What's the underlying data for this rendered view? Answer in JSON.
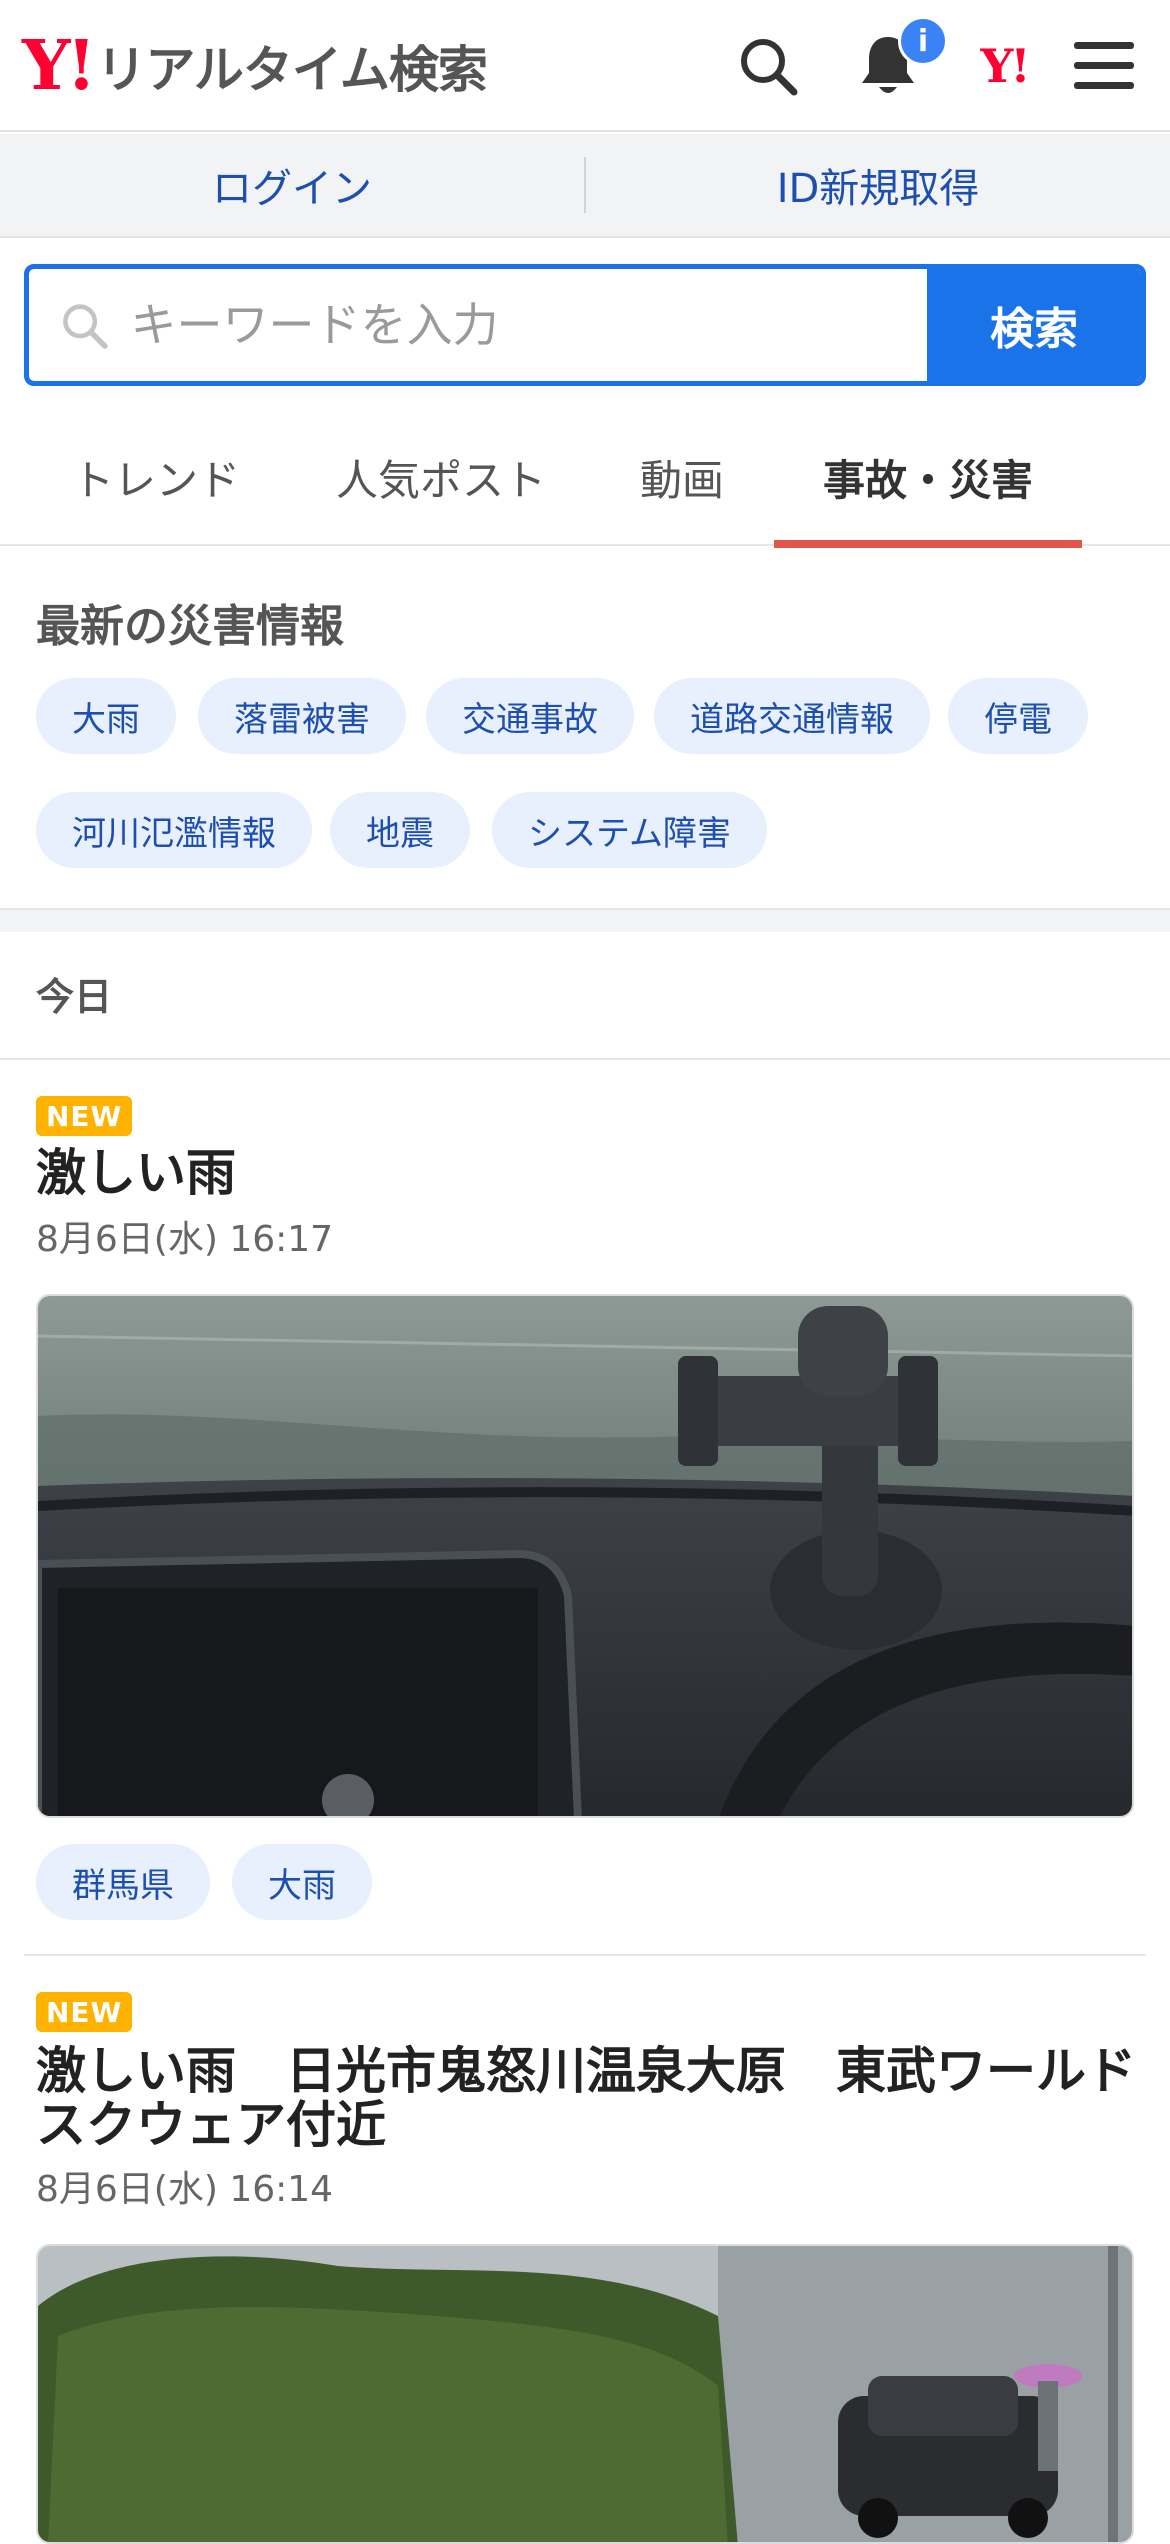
{
  "header": {
    "logo_mark": "Y!",
    "logo_text": "リアルタイム検索",
    "notification_badge": "i",
    "yjapan_mark": "Y!"
  },
  "auth": {
    "login": "ログイン",
    "register": "ID新規取得"
  },
  "search": {
    "placeholder": "キーワードを入力",
    "button": "検索"
  },
  "tabs": [
    "トレンド",
    "人気ポスト",
    "動画",
    "事故・災害"
  ],
  "active_tab": "事故・災害",
  "disaster": {
    "title": "最新の災害情報",
    "chips": [
      "大雨",
      "落雷被害",
      "交通事故",
      "道路交通情報",
      "停電",
      "河川氾濫情報",
      "地震",
      "システム障害"
    ]
  },
  "day_label": "今日",
  "posts": [
    {
      "badge": "NEW",
      "title": "激しい雨",
      "time": "8月6日(水) 16:17",
      "tags": [
        "群馬県",
        "大雨"
      ]
    },
    {
      "badge": "NEW",
      "title": "激しい雨　日光市鬼怒川温泉大原　東武ワールドスクウェア付近",
      "time": "8月6日(水) 16:14"
    }
  ],
  "colors": {
    "brand_red": "#ff0033",
    "primary_blue": "#1a73e8",
    "link_blue": "#1d4fb0",
    "chip_bg": "#e8f0fd",
    "tab_underline": "#e0574a",
    "new_badge": "#ffb300",
    "notification_blue": "#3b82f6"
  },
  "icons": [
    "search-icon",
    "bell-icon",
    "yahoo-japan-icon",
    "menu-icon",
    "search-field-icon"
  ]
}
